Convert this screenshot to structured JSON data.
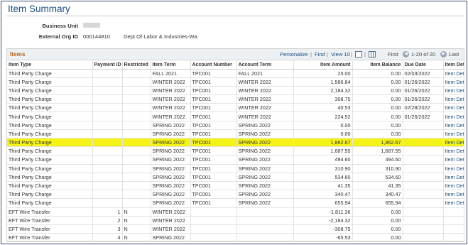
{
  "page_title": "Item Summary",
  "header": {
    "business_unit_label": "Business Unit",
    "external_org_label": "External Org ID",
    "external_org_id": "000144810",
    "external_org_name": "Dept Of Labor & Industries-Wa"
  },
  "grid": {
    "title": "Items",
    "personalize": "Personalize",
    "find": "Find",
    "view": "View 10",
    "first": "First",
    "range": "1-20 of 20",
    "last": "Last",
    "columns": [
      "Item Type",
      "Payment ID",
      "Restricted",
      "Item Term",
      "Account Number",
      "Account Term",
      "Item Amount",
      "Item Balance",
      "Due Date",
      "Item Details"
    ],
    "highlight_color": "#f4f216",
    "rows": [
      [
        "Third Party Charge",
        "",
        "",
        "FALL 2021",
        "TPC001",
        "FALL 2021",
        "25.00",
        "0.00",
        "02/03/2022",
        "Item Details"
      ],
      [
        "Third Party Charge",
        "",
        "",
        "WINTER 2022",
        "TPC001",
        "WINTER 2022",
        "1,586.84",
        "0.00",
        "01/26/2022",
        "Item Details"
      ],
      [
        "Third Party Charge",
        "",
        "",
        "WINTER 2022",
        "TPC001",
        "WINTER 2022",
        "2,184.32",
        "0.00",
        "01/26/2022",
        "Item Details"
      ],
      [
        "Third Party Charge",
        "",
        "",
        "WINTER 2022",
        "TPC001",
        "WINTER 2022",
        "308.75",
        "0.00",
        "01/26/2022",
        "Item Details"
      ],
      [
        "Third Party Charge",
        "",
        "",
        "WINTER 2022",
        "TPC001",
        "WINTER 2022",
        "40.53",
        "0.00",
        "02/28/2022",
        "Item Details"
      ],
      [
        "Third Party Charge",
        "",
        "",
        "WINTER 2022",
        "TPC001",
        "WINTER 2022",
        "224.52",
        "0.00",
        "01/26/2022",
        "Item Details"
      ],
      [
        "Third Party Charge",
        "",
        "",
        "SPRING 2022",
        "TPC001",
        "SPRING 2022",
        "0.00",
        "0.00",
        "",
        "Item Details"
      ],
      [
        "Third Party Charge",
        "",
        "",
        "SPRING 2022",
        "TPC001",
        "SPRING 2022",
        "0.00",
        "0.00",
        "",
        "Item Details"
      ],
      [
        "Third Party Charge",
        "",
        "",
        "SPRING 2022",
        "TPC001",
        "SPRING 2022",
        "1,862.67",
        "1,862.67",
        "",
        "Item Details"
      ],
      [
        "Third Party Charge",
        "",
        "",
        "SPRING 2022",
        "TPC001",
        "SPRING 2022",
        "1,687.55",
        "1,687.55",
        "",
        "Item Details"
      ],
      [
        "Third Party Charge",
        "",
        "",
        "SPRING 2022",
        "TPC001",
        "SPRING 2022",
        "494.60",
        "494.60",
        "",
        "Item Details"
      ],
      [
        "Third Party Charge",
        "",
        "",
        "SPRING 2022",
        "TPC001",
        "SPRING 2022",
        "310.90",
        "310.90",
        "",
        "Item Details"
      ],
      [
        "Third Party Charge",
        "",
        "",
        "SPRING 2022",
        "TPC001",
        "SPRING 2022",
        "534.60",
        "534.60",
        "",
        "Item Details"
      ],
      [
        "Third Party Charge",
        "",
        "",
        "SPRING 2022",
        "TPC001",
        "SPRING 2022",
        "41.35",
        "41.35",
        "",
        "Item Details"
      ],
      [
        "Third Party Charge",
        "",
        "",
        "SPRING 2022",
        "TPC001",
        "SPRING 2022",
        "340.47",
        "340.47",
        "",
        "Item Details"
      ],
      [
        "Third Party Charge",
        "",
        "",
        "SPRING 2022",
        "TPC001",
        "SPRING 2022",
        "655.94",
        "655.94",
        "",
        "Item Details"
      ],
      [
        "EFT Wire Transfer",
        "1",
        "N",
        "WINTER 2022",
        "",
        "",
        "-1,811.36",
        "0.00",
        "",
        ""
      ],
      [
        "EFT Wire Transfer",
        "2",
        "N",
        "WINTER 2022",
        "",
        "",
        "-2,184.32",
        "0.00",
        "",
        ""
      ],
      [
        "EFT Wire Transfer",
        "3",
        "N",
        "WINTER 2022",
        "",
        "",
        "-308.75",
        "0.00",
        "",
        ""
      ],
      [
        "EFT Wire Transfer",
        "4",
        "N",
        "SPRING 2022",
        "",
        "",
        "-65.53",
        "0.00",
        "",
        ""
      ]
    ],
    "highlighted_row_index": 8
  }
}
